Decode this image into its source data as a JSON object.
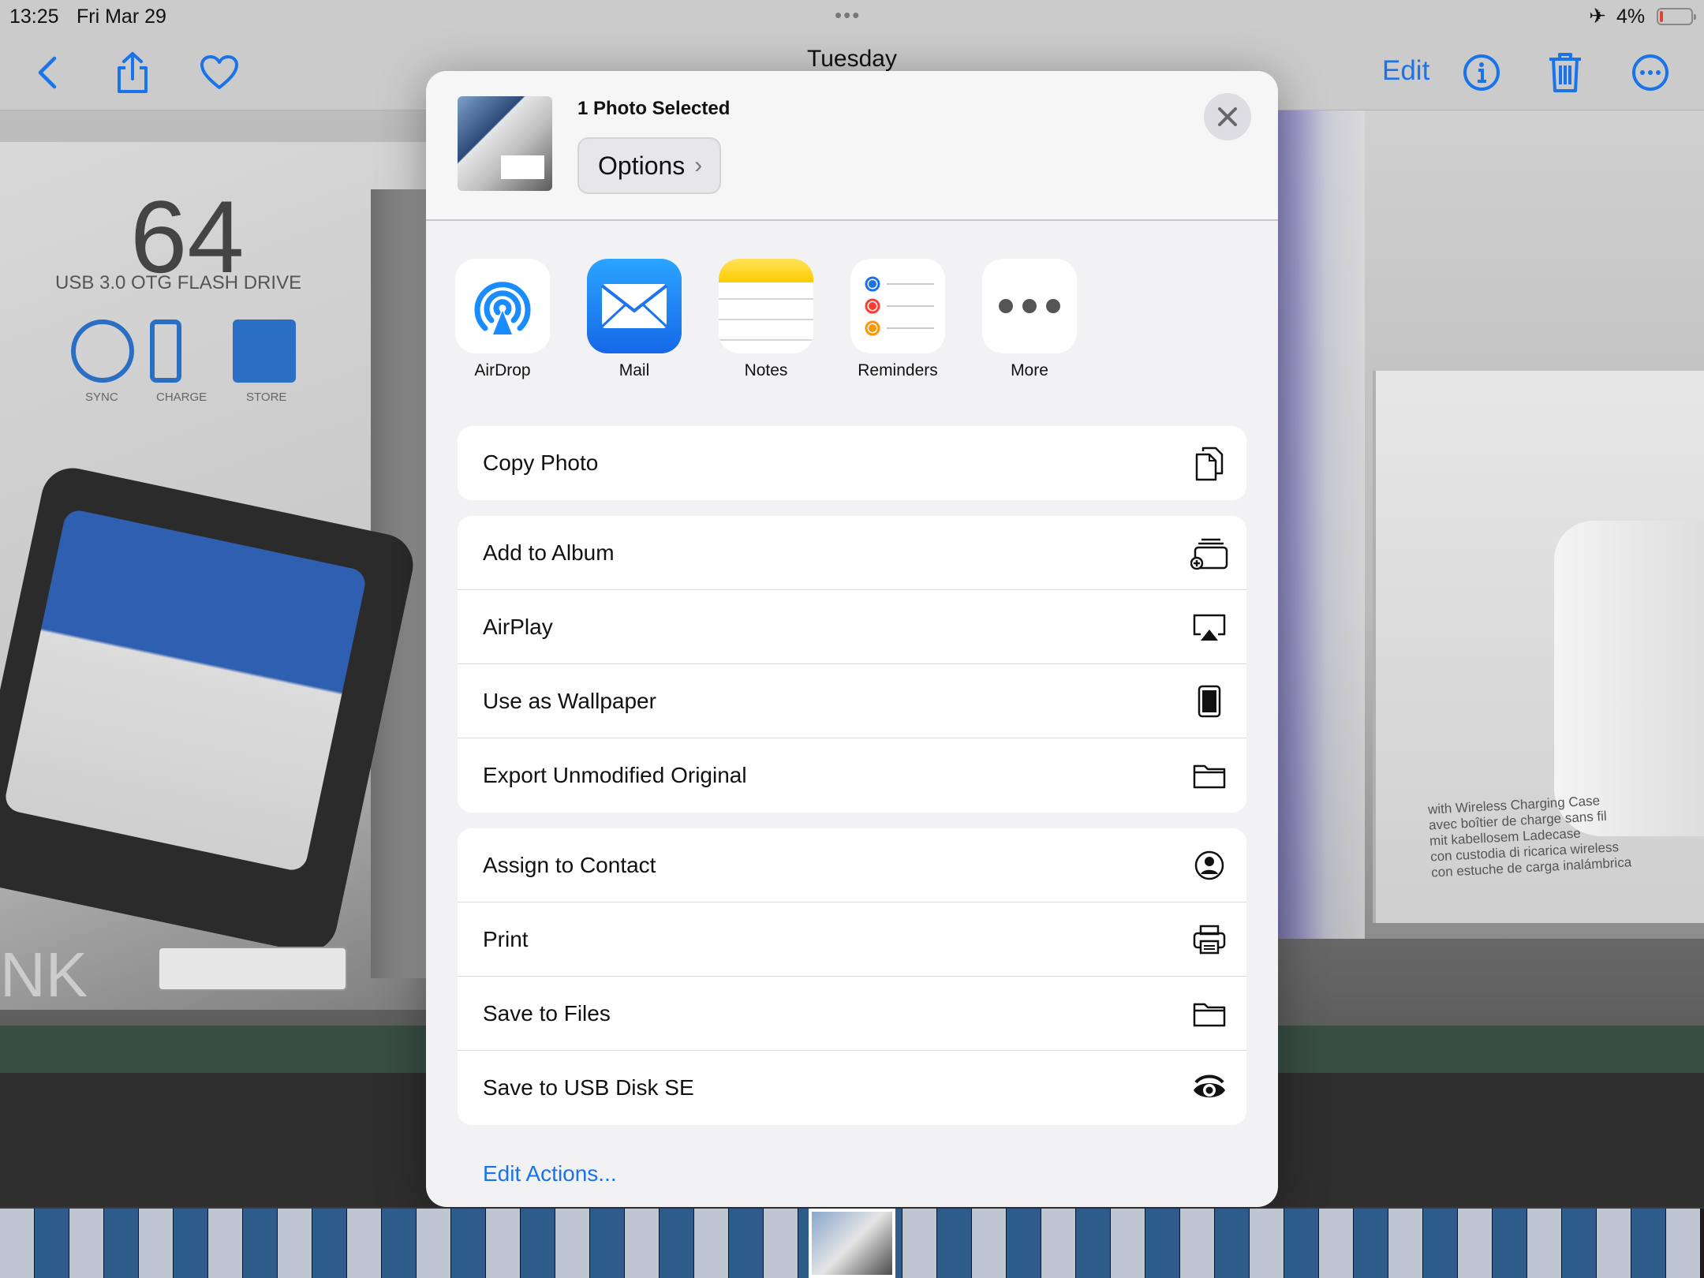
{
  "status_bar": {
    "time": "13:25",
    "date": "Fri Mar 29",
    "battery_percent": "4%",
    "battery_level": 0.04,
    "airplane_mode": true
  },
  "nav_bar": {
    "title": "Tuesday",
    "edit_label": "Edit",
    "accent_color": "#1a73e8",
    "icons": [
      "back-chevron-icon",
      "share-icon",
      "heart-icon",
      "info-icon",
      "trash-icon",
      "more-icon"
    ]
  },
  "share_sheet": {
    "header": {
      "selection_title": "1 Photo Selected",
      "options_label": "Options"
    },
    "apps": [
      {
        "label": "AirDrop",
        "icon": "airdrop-icon"
      },
      {
        "label": "Mail",
        "icon": "mail-icon"
      },
      {
        "label": "Notes",
        "icon": "notes-icon"
      },
      {
        "label": "Reminders",
        "icon": "reminders-icon"
      },
      {
        "label": "More",
        "icon": "more-apps-icon"
      }
    ],
    "action_groups": [
      [
        {
          "label": "Copy Photo",
          "icon": "copy-icon"
        }
      ],
      [
        {
          "label": "Add to Album",
          "icon": "add-to-album-icon"
        },
        {
          "label": "AirPlay",
          "icon": "airplay-icon"
        },
        {
          "label": "Use as Wallpaper",
          "icon": "ipad-icon"
        },
        {
          "label": "Export Unmodified Original",
          "icon": "folder-icon"
        }
      ],
      [
        {
          "label": "Assign to Contact",
          "icon": "contact-icon"
        },
        {
          "label": "Print",
          "icon": "printer-icon"
        },
        {
          "label": "Save to Files",
          "icon": "folder-icon"
        },
        {
          "label": "Save to USB Disk SE",
          "icon": "eye-icon"
        }
      ]
    ],
    "edit_actions_label": "Edit Actions..."
  }
}
